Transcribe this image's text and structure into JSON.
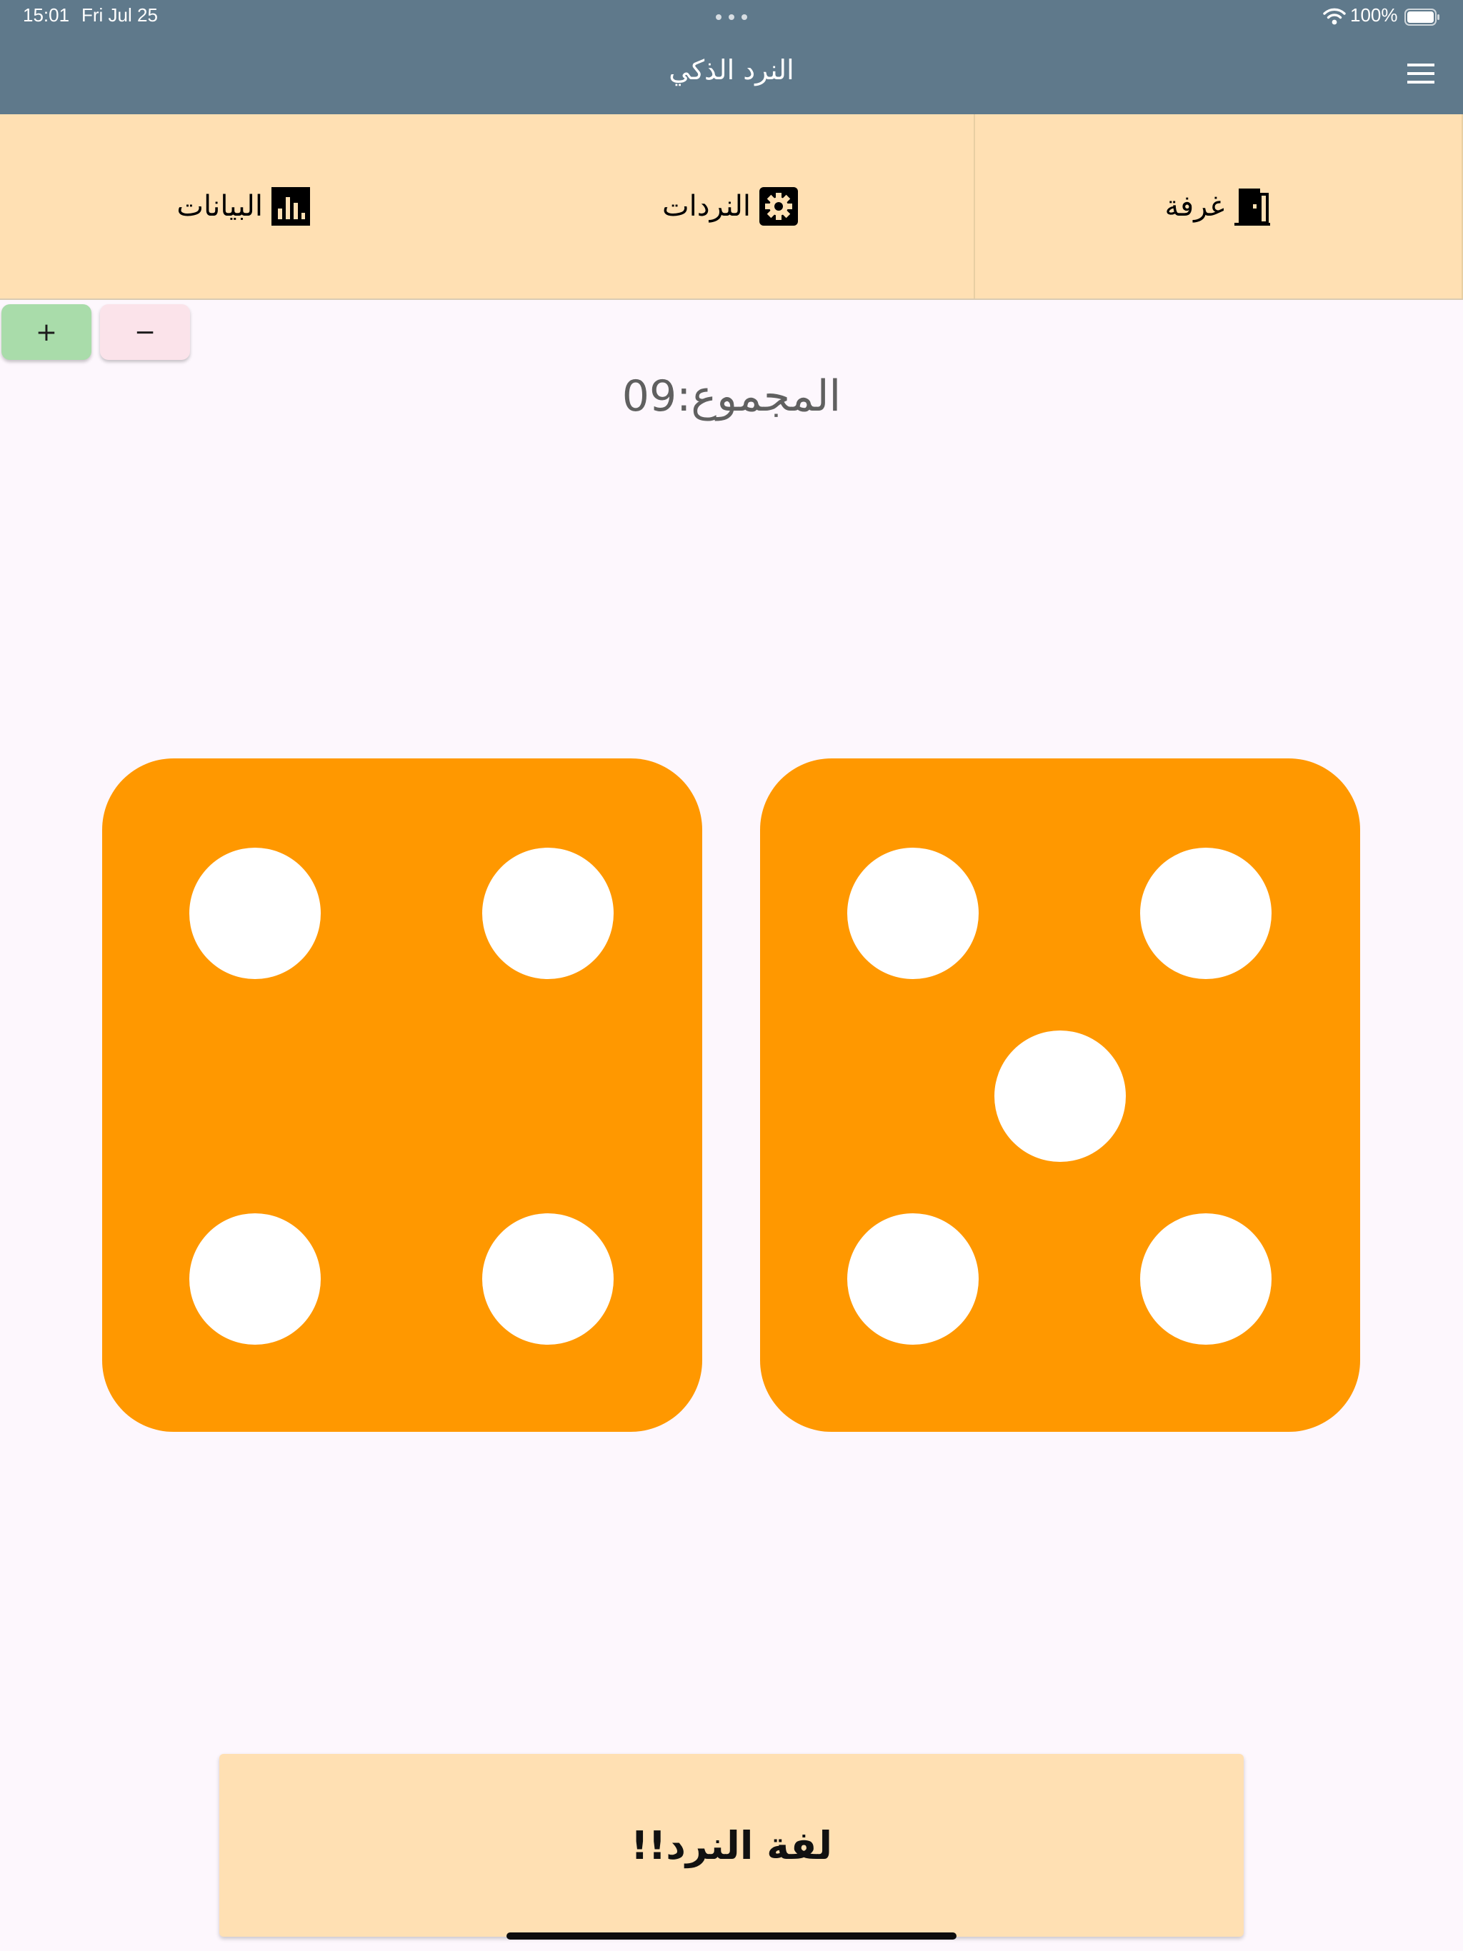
{
  "status_bar": {
    "time": "15:01",
    "date": "Fri Jul 25",
    "battery": "100%"
  },
  "app_bar": {
    "title": "النرد الذكي",
    "menu_icon": "hamburger-menu-icon"
  },
  "tabs": [
    {
      "label": "البيانات",
      "icon": "bar-chart-icon"
    },
    {
      "label": "النردات",
      "icon": "gear-icon"
    },
    {
      "label": "غرفة",
      "icon": "door-icon"
    }
  ],
  "controls": {
    "plus_label": "+",
    "minus_label": "−"
  },
  "total": {
    "label": "المجموع:09"
  },
  "dice": [
    {
      "position": "left",
      "value": 4
    },
    {
      "position": "right",
      "value": 5
    }
  ],
  "roll_button": {
    "label": "لفة النرد!!"
  },
  "colors": {
    "app_bar": "#5f798b",
    "tab_bar": "#ffe0b3",
    "die": "#ff9800",
    "pip": "#ffffff",
    "background": "#fdf7fd",
    "plus_button": "#a9dcaa",
    "minus_button": "#fbe3ea"
  }
}
